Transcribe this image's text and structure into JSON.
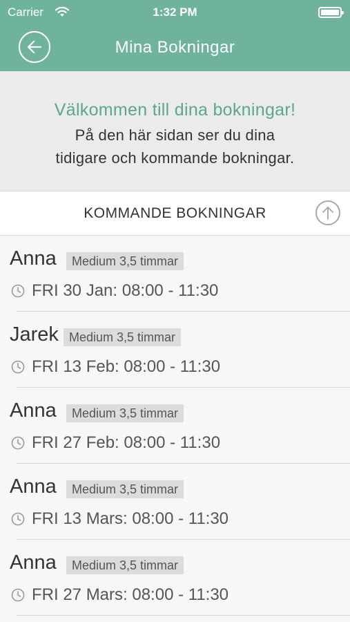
{
  "status_bar": {
    "carrier": "Carrier",
    "time": "1:32 PM"
  },
  "nav": {
    "title": "Mina Bokningar"
  },
  "welcome": {
    "title": "Välkommen till dina bokningar!",
    "line1": "På den här sidan ser du dina",
    "line2": "tidigare och kommande bokningar."
  },
  "section": {
    "title": "KOMMANDE BOKNINGAR"
  },
  "bookings": [
    {
      "name": "Anna",
      "badge": "Medium 3,5 timmar",
      "time": "FRI 30 Jan: 08:00 - 11:30"
    },
    {
      "name": "Jarek",
      "badge": "Medium 3,5 timmar",
      "time": "FRI 13 Feb: 08:00 - 11:30"
    },
    {
      "name": "Anna",
      "badge": "Medium 3,5 timmar",
      "time": "FRI 27 Feb: 08:00 - 11:30"
    },
    {
      "name": "Anna",
      "badge": "Medium 3,5 timmar",
      "time": "FRI 13 Mars: 08:00 - 11:30"
    },
    {
      "name": "Anna",
      "badge": "Medium 3,5 timmar",
      "time": "FRI 27 Mars: 08:00 - 11:30"
    }
  ],
  "icons": {
    "wifi": "wifi-icon",
    "battery": "battery-icon",
    "back": "back-arrow-icon",
    "scroll_up": "arrow-up-icon",
    "clock": "clock-icon"
  },
  "colors": {
    "header": "#6fb49a",
    "accent_text": "#5ba888",
    "badge_bg": "#dcdcdc"
  }
}
